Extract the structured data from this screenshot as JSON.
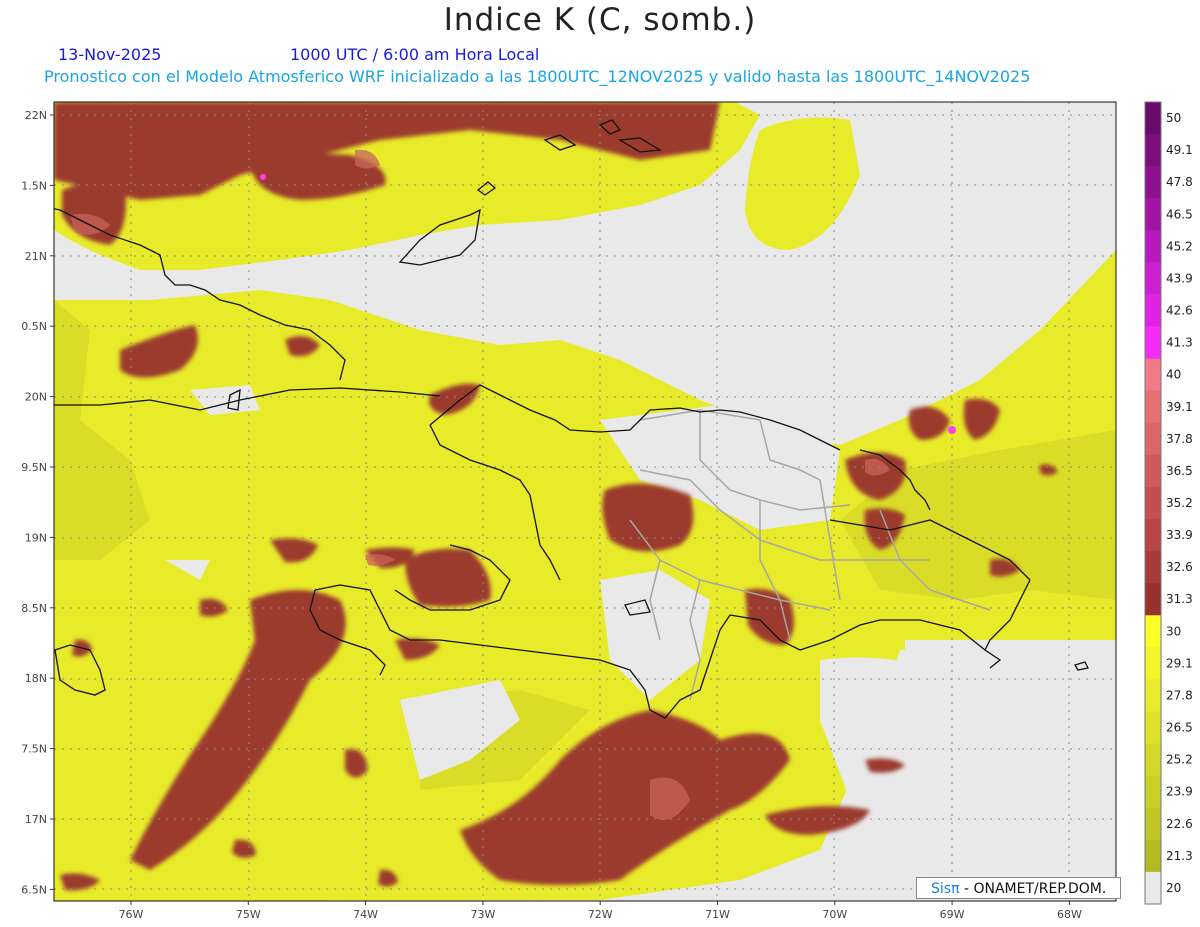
{
  "header": {
    "title": "Indice K (C, somb.)",
    "date": "13-Nov-2025",
    "time": "1000 UTC / 6:00 am Hora Local",
    "subtitle": "Pronostico con el Modelo Atmosferico WRF inicializado a las 1800UTC_12NOV2025 y valido hasta las  1800UTC_14NOV2025"
  },
  "axes": {
    "lon_labels": [
      "76W",
      "75W",
      "74W",
      "73W",
      "72W",
      "71W",
      "70W",
      "69W",
      "68W"
    ],
    "lat_labels": [
      "22N",
      "1.5N",
      "21N",
      "0.5N",
      "20N",
      "9.5N",
      "19N",
      "8.5N",
      "18N",
      "7.5N",
      "17N",
      "6.5N"
    ],
    "lon_range": [
      -76.6,
      -67.55
    ],
    "lat_range": [
      16.4,
      22.1
    ]
  },
  "colorbar": {
    "ticks": [
      "50",
      "49.1",
      "47.8",
      "46.5",
      "45.2",
      "43.9",
      "42.6",
      "41.3",
      "40",
      "39.1",
      "37.8",
      "36.5",
      "35.2",
      "33.9",
      "32.6",
      "31.3",
      "30",
      "29.1",
      "27.8",
      "26.5",
      "25.2",
      "23.9",
      "22.6",
      "21.3",
      "20"
    ],
    "colors": [
      "#6a0a6a",
      "#7d0d7d",
      "#8e0f90",
      "#a213a6",
      "#b818bd",
      "#cc1fd2",
      "#e024e6",
      "#f42cf8",
      "#f07a86",
      "#e66f6f",
      "#dc6565",
      "#d05a5a",
      "#c44f4f",
      "#b84444",
      "#a83b35",
      "#98322b",
      "#ffff28",
      "#f5f52a",
      "#e9ec2c",
      "#dde22b",
      "#d2d82a",
      "#c8cf28",
      "#bec525",
      "#b4bb22",
      "#e9e9e9"
    ]
  },
  "credit": {
    "sis": "Sisπ",
    "rest": " - ONAMET/REP.DOM."
  }
}
